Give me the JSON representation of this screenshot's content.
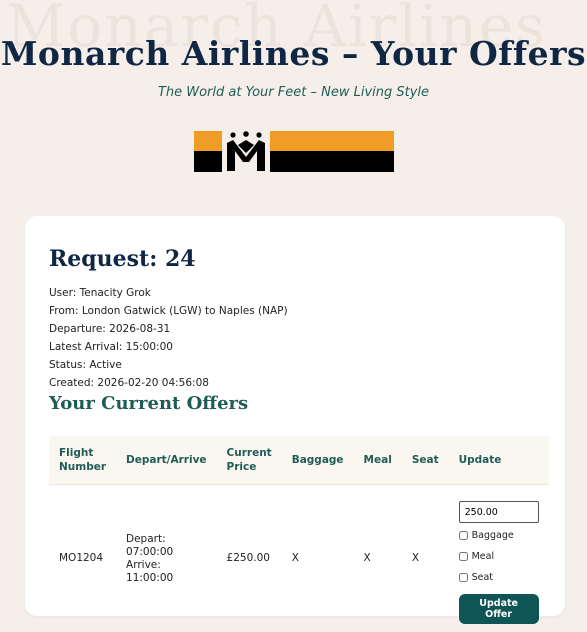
{
  "watermark": "Monarch Airlines",
  "header": {
    "title": "Monarch Airlines – Your Offers",
    "tagline": "The World at Your Feet – New Living Style"
  },
  "brand_colors": {
    "orange": "#f29c28",
    "black": "#000000",
    "navy": "#0f2744",
    "teal": "#1f5c56"
  },
  "request": {
    "title": "Request: 24",
    "user": "User: Tenacity Grok",
    "route": "From: London Gatwick (LGW) to Naples (NAP)",
    "departure": "Departure: 2026-08-31",
    "latest_arrival": "Latest Arrival: 15:00:00",
    "status": "Status: Active",
    "created": "Created: 2026-02-20 04:56:08"
  },
  "offers": {
    "title": "Your Current Offers",
    "columns": [
      "Flight Number",
      "Depart/Arrive",
      "Current Price",
      "Baggage",
      "Meal",
      "Seat",
      "Update"
    ],
    "rows": [
      {
        "flight_number": "MO1204",
        "depart": "Depart: 07:00:00",
        "arrive": "Arrive: 11:00:00",
        "price": "£250.00",
        "baggage": "X",
        "meal": "X",
        "seat": "X",
        "price_input": "250.00",
        "opt_baggage": "Baggage",
        "opt_meal": "Meal",
        "opt_seat": "Seat",
        "update_label": "Update Offer"
      }
    ]
  }
}
